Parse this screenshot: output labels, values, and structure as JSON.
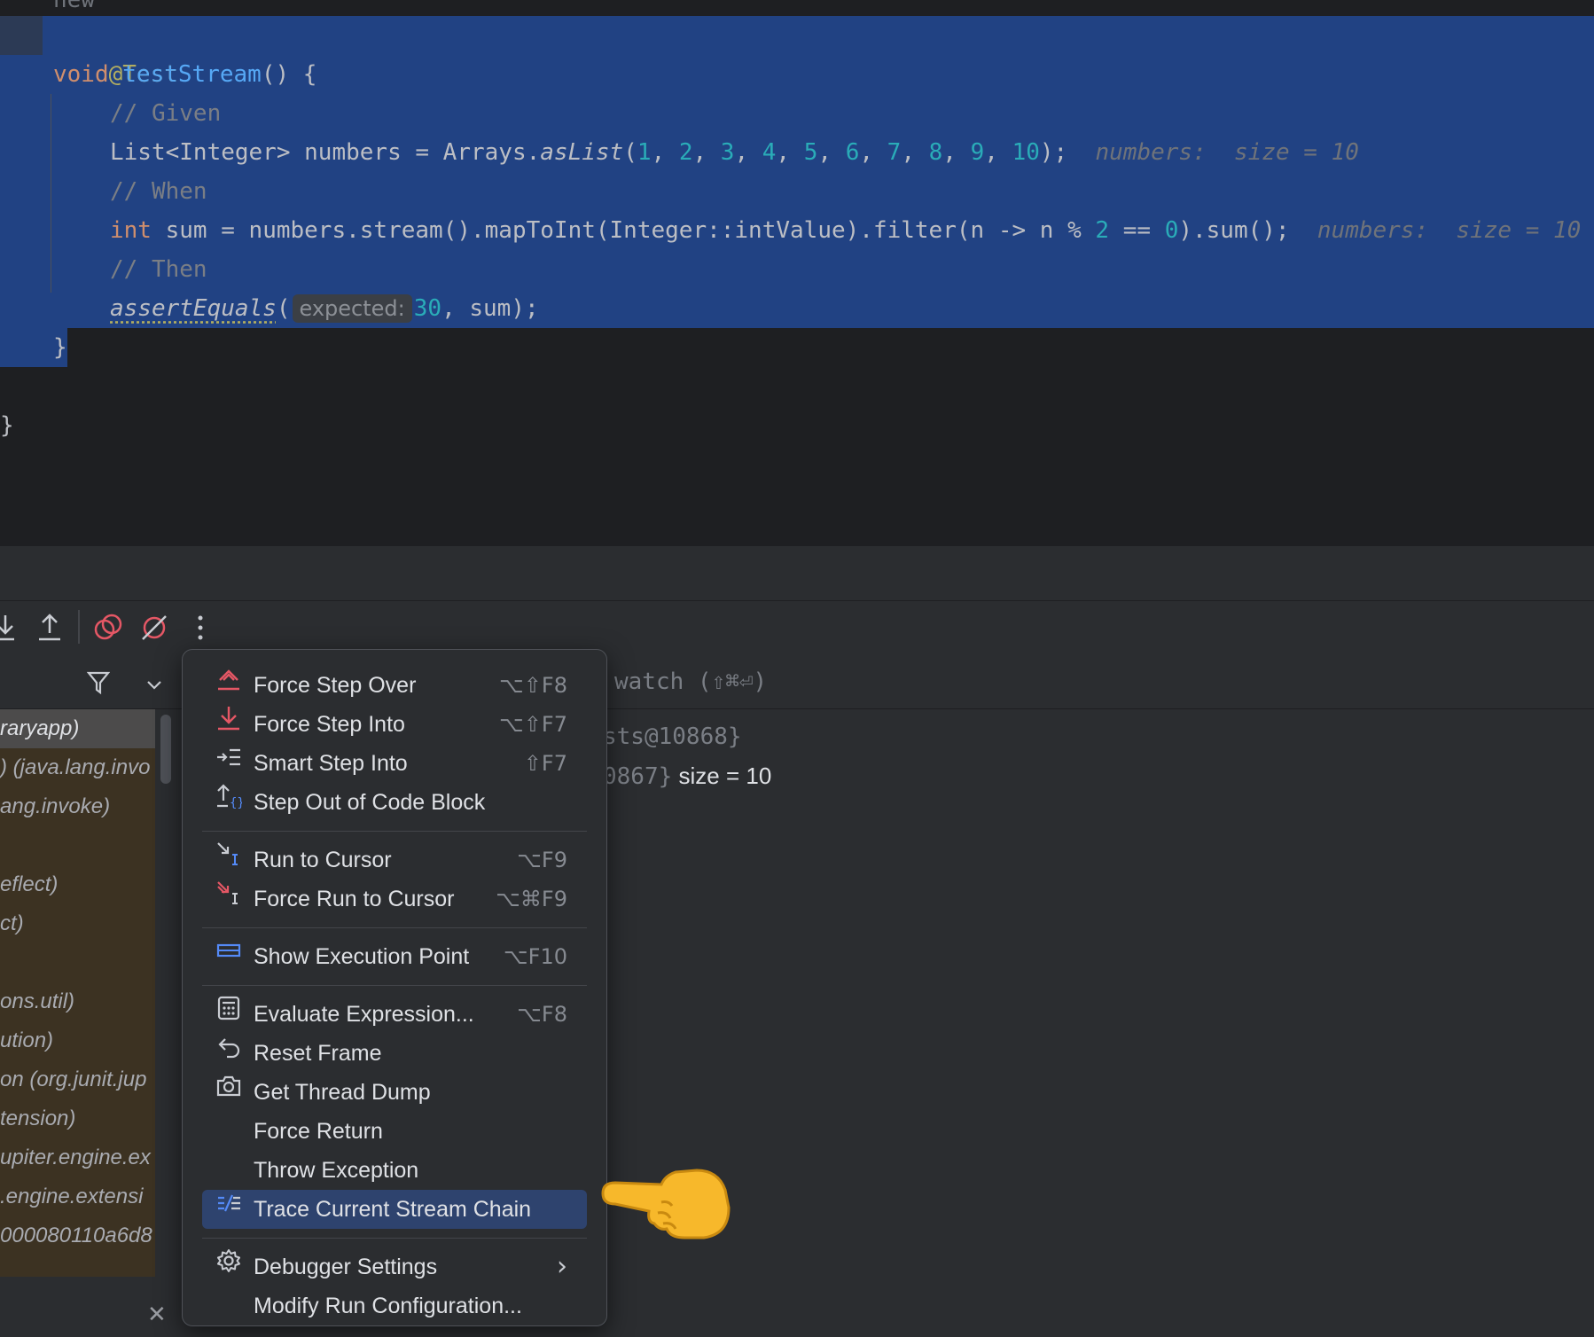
{
  "editor": {
    "top_cut_text": "new",
    "lines": {
      "annotation": "@Test",
      "method_kw": "void",
      "method_name": "testStream",
      "method_rest": "() {",
      "comment_given": "// Given",
      "list_decl_a": "List<Integer> numbers = Arrays.",
      "list_decl_fn": "asList",
      "list_nums": [
        "1",
        "2",
        "3",
        "4",
        "5",
        "6",
        "7",
        "8",
        "9",
        "10"
      ],
      "list_decl_end": ");",
      "list_hint": "numbers:  size = 10",
      "comment_when": "// When",
      "sum_kw": "int",
      "sum_a": " sum = numbers.stream().mapToInt(Integer::intValue).filter(n -> n % ",
      "sum_num1": "2",
      "sum_b": " == ",
      "sum_num2": "0",
      "sum_c": ").sum();",
      "sum_hint": "numbers:  size = 10",
      "comment_then": "// Then",
      "assert_fn": "assertEquals",
      "assert_open": "(",
      "assert_inlay": "expected:",
      "assert_num": "30",
      "assert_rest": ", sum);",
      "close_method": "}",
      "close_class": "}"
    }
  },
  "debug": {
    "toolbar": {
      "step_into_icon": "step-into",
      "step_out_icon": "step-out",
      "view_breakpoints_icon": "view-breakpoints",
      "mute_breakpoints_icon": "mute-breakpoints",
      "more_icon": "more"
    },
    "frames": [
      "raryapp)",
      ") (java.lang.invo",
      "ang.invoke)",
      "",
      "eflect)",
      "ct)",
      "",
      "ons.util)",
      "ution)",
      "on (org.junit.jup",
      "tension)",
      "upiter.engine.ex",
      ".engine.extensi",
      "000080110a6d8",
      "..."
    ],
    "vars_header_hint": "watch (⇧⌘⏎)",
    "vars": {
      "row1": "sts@10868}",
      "row2_a": "0867}",
      "row2_b": " size = 10"
    }
  },
  "menu": {
    "items": [
      {
        "label": "Force Step Over",
        "shortcut": "⌥⇧F8",
        "icon": "force-step-over"
      },
      {
        "label": "Force Step Into",
        "shortcut": "⌥⇧F7",
        "icon": "force-step-into"
      },
      {
        "label": "Smart Step Into",
        "shortcut": "⇧F7",
        "icon": "smart-step-into"
      },
      {
        "label": "Step Out of Code Block",
        "shortcut": "",
        "icon": "step-out-code-block"
      },
      {
        "label": "Run to Cursor",
        "shortcut": "⌥F9",
        "icon": "run-to-cursor"
      },
      {
        "label": "Force Run to Cursor",
        "shortcut": "⌥⌘F9",
        "icon": "force-run-to-cursor"
      },
      {
        "label": "Show Execution Point",
        "shortcut": "⌥F10",
        "icon": "show-execution-point"
      },
      {
        "label": "Evaluate Expression...",
        "shortcut": "⌥F8",
        "icon": "calculator"
      },
      {
        "label": "Reset Frame",
        "shortcut": "",
        "icon": "reset-frame"
      },
      {
        "label": "Get Thread Dump",
        "shortcut": "",
        "icon": "camera"
      },
      {
        "label": "Force Return",
        "shortcut": "",
        "icon": ""
      },
      {
        "label": "Throw Exception",
        "shortcut": "",
        "icon": ""
      },
      {
        "label": "Trace Current Stream Chain",
        "shortcut": "",
        "icon": "trace-stream"
      },
      {
        "label": "Debugger Settings",
        "shortcut": "›",
        "icon": "gear"
      },
      {
        "label": "Modify Run Configuration...",
        "shortcut": "",
        "icon": ""
      }
    ],
    "selected_index": 12
  },
  "pointer_emoji": "👉"
}
